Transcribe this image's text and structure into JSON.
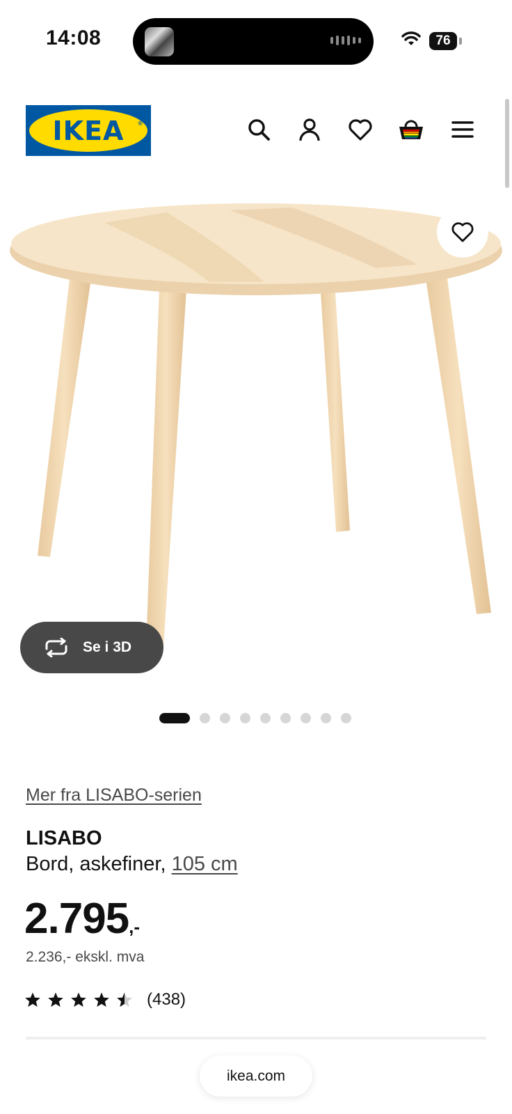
{
  "status_bar": {
    "time": "14:08",
    "battery": "76"
  },
  "header": {
    "logo_text": "IKEA",
    "icons": [
      "search-icon",
      "account-icon",
      "heart-icon",
      "cart-icon",
      "menu-icon"
    ]
  },
  "gallery": {
    "view_3d_label": "Se i 3D",
    "image_count": 9,
    "active_index": 0
  },
  "product": {
    "series_link": "Mer fra LISABO-serien",
    "name": "LISABO",
    "description": "Bord, askefiner,",
    "size_link": "105 cm",
    "price_integer": "2.795",
    "price_suffix": ",-",
    "price_ex_vat": "2.236,- ekskl. mva",
    "rating": 4.5,
    "review_count": "(438)"
  },
  "browser": {
    "url": "ikea.com"
  },
  "colors": {
    "brand_blue": "#0058a3",
    "brand_yellow": "#ffdb00",
    "text": "#111111",
    "button_dark": "#484848"
  }
}
